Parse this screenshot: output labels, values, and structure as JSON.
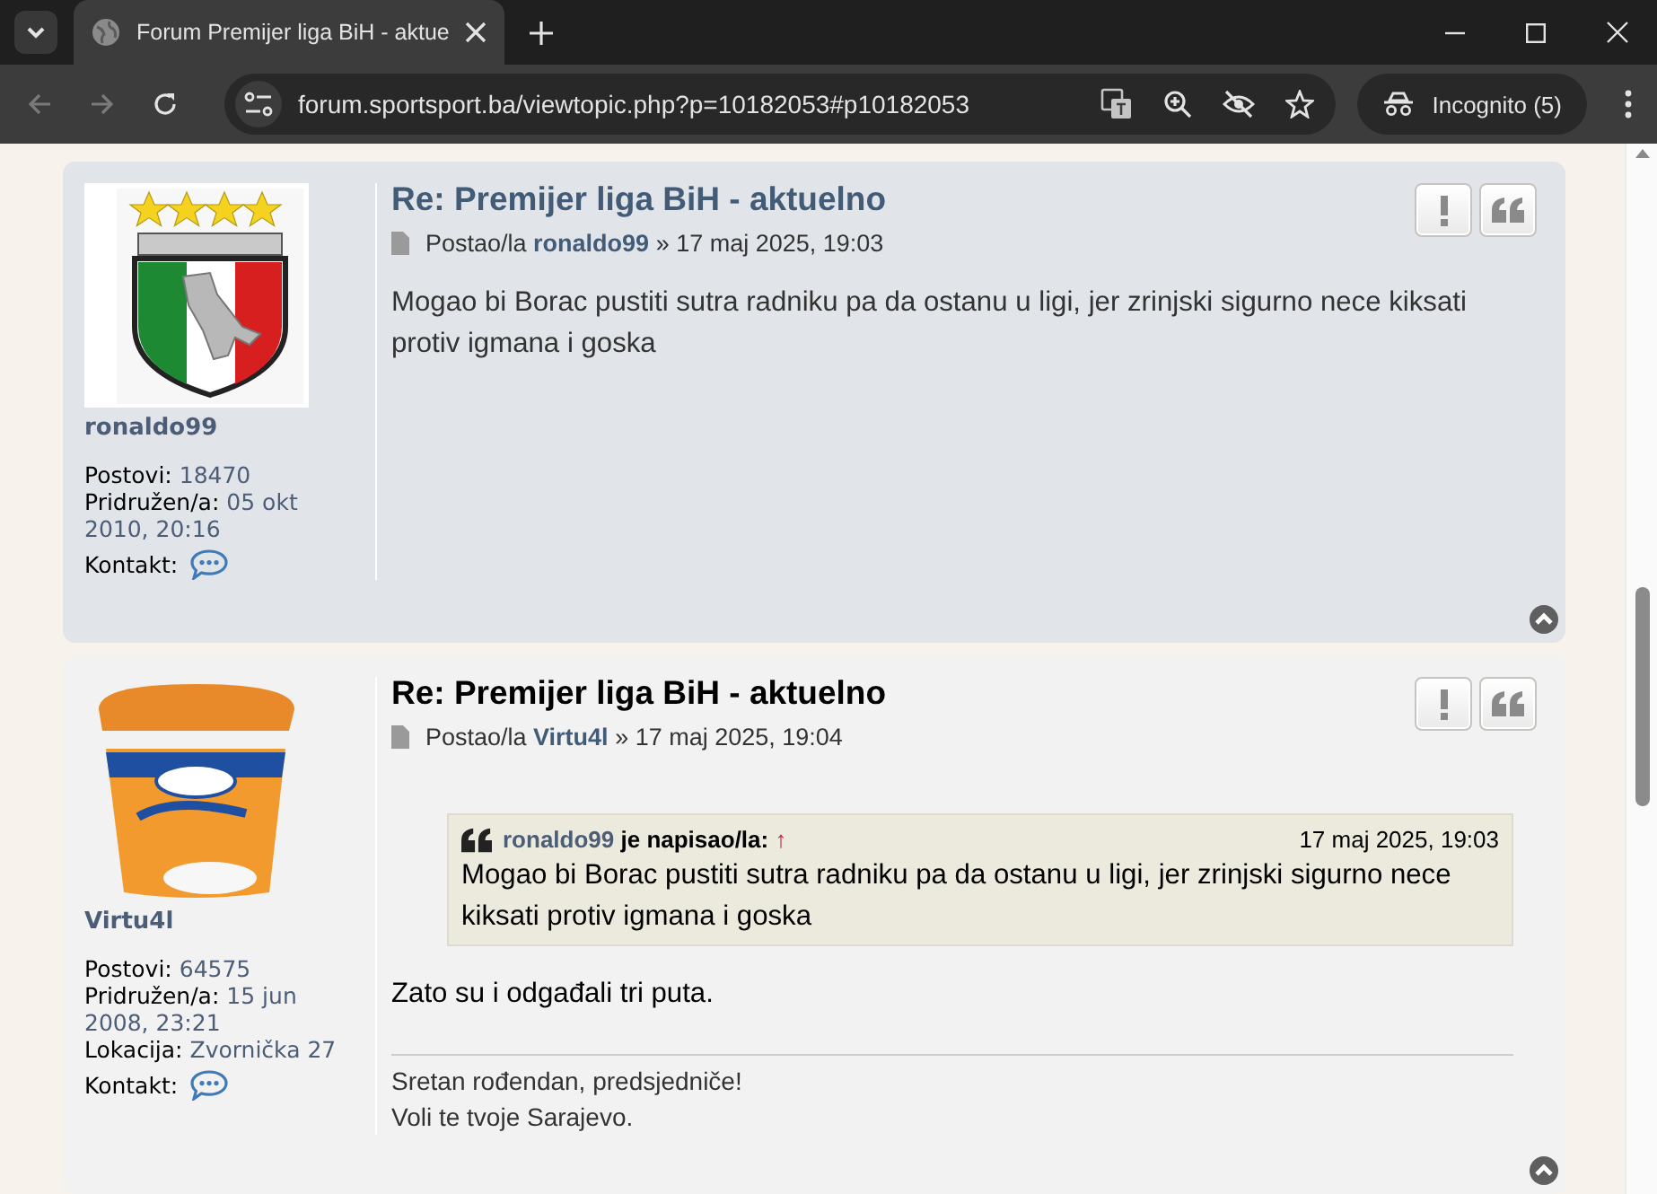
{
  "browser": {
    "tab_title": "Forum Premijer liga BiH - aktue",
    "url": "forum.sportsport.ba/viewtopic.php?p=10182053#p10182053",
    "profile_label": "Incognito (5)"
  },
  "posts": [
    {
      "kind": "dark",
      "username": "ronaldo99",
      "stats": [
        {
          "label": "Postovi:",
          "value": "18470"
        },
        {
          "label": "Pridružen/a:",
          "value": "05 okt 2010, 20:16"
        }
      ],
      "contact_label": "Kontakt:",
      "title": "Re: Premijer liga BiH - aktuelno",
      "byline_prefix": "Postao/la",
      "author": "ronaldo99",
      "separator": "»",
      "date": "17 maj 2025, 19:03",
      "body": "Mogao bi Borac pustiti sutra radniku pa da ostanu u ligi, jer zrinjski sigurno nece kiksati protiv igmana i goska"
    },
    {
      "kind": "light",
      "username": "Virtu4l",
      "stats": [
        {
          "label": "Postovi:",
          "value": "64575"
        },
        {
          "label": "Pridružen/a:",
          "value": "15 jun 2008, 23:21"
        },
        {
          "label": "Lokacija:",
          "value": "Zvornička 27"
        }
      ],
      "contact_label": "Kontakt:",
      "title": "Re: Premijer liga BiH - aktuelno",
      "byline_prefix": "Postao/la",
      "author": "Virtu4l",
      "separator": "»",
      "date": "17 maj 2025, 19:04",
      "quote": {
        "author": "ronaldo99",
        "verb": "je napisao/la:",
        "arrow": "↑",
        "date": "17 maj 2025, 19:03",
        "text": "Mogao bi Borac pustiti sutra radniku pa da ostanu u ligi, jer zrinjski sigurno nece kiksati protiv igmana i goska"
      },
      "body": "Zato su i odgađali tri puta.",
      "signature": [
        "Sretan rođendan, predsjedniče!",
        "Voli te tvoje Sarajevo."
      ]
    }
  ]
}
